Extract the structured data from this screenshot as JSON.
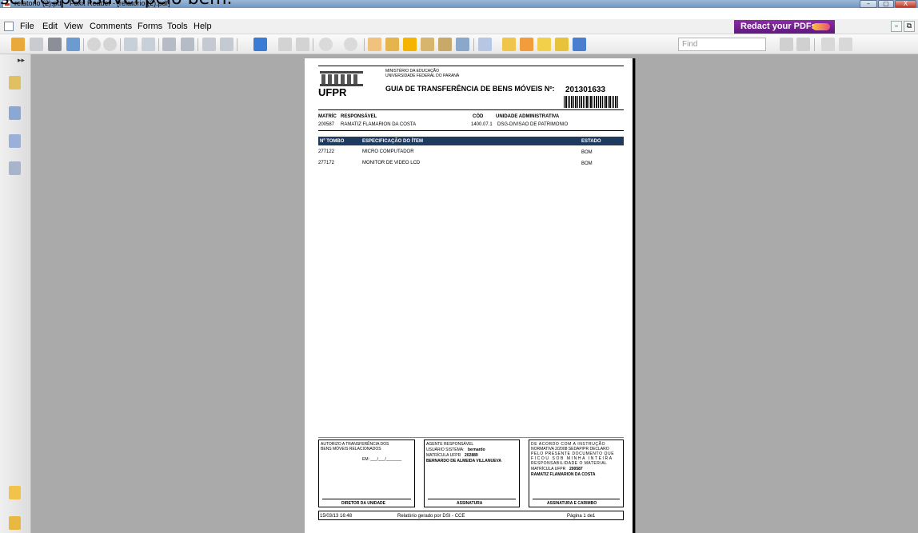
{
  "overlay_caption": "ser responsável pelo bem.",
  "window": {
    "title": "relatorio (2).pdf - Foxit Reader - [relatorio (2).pdf]",
    "minimize": "–",
    "maximize": "▢",
    "close": "X"
  },
  "menu": {
    "items": [
      "File",
      "Edit",
      "View",
      "Comments",
      "Forms",
      "Tools",
      "Help"
    ],
    "promo": "Redact your PDFs",
    "mdi_min": "–",
    "mdi_restore": "⧉"
  },
  "toolbar": {
    "find_placeholder": "Find",
    "accent": "#3a7bd5"
  },
  "document": {
    "header": {
      "ministry": "MINISTÉRIO DA EDUCAÇÃO",
      "university": "UNIVERSIDADE FEDERAL DO PARANÁ",
      "logo_text": "UFPR",
      "title": "GUIA DE TRANSFERÊNCIA DE BENS MÓVEIS Nº:",
      "number": "201301633"
    },
    "info": {
      "headers": [
        "MATRÍC",
        "RESPONSÁVEL",
        "CÓD",
        "UNIDADE ADMINISTRATIVA"
      ],
      "values": [
        "200587",
        "RAMATIZ FLAMARION DA COSTA",
        "1400.07.1",
        "DSG-DIVISAO DE PATRIMONIO"
      ]
    },
    "items_table": {
      "headers": [
        "Nº TOMBO",
        "ESPECIFICAÇÃO DO ÍTEM",
        "ESTADO"
      ],
      "rows": [
        [
          "277122",
          "MICRO COMPUTADOR",
          "BOM"
        ],
        [
          "277172",
          "MONITOR DE VIDEO LCD",
          "BOM"
        ]
      ],
      "header_bg": "#1f3a5f"
    },
    "signatures": {
      "left": {
        "line1": "AUTORIZO A TRANSFERÊNCIA DOS",
        "line2": "BENS MÓVEIS RELACIONADOS",
        "date": "EM: ___/___/_______",
        "footer": "DIRETOR DA UNIDADE"
      },
      "middle": {
        "line1": "AGENTE RESPONSÁVEL",
        "line2_label": "USUÁRIO SISTEMA:",
        "line2_value": "bernardo",
        "line3_label": "MATRÍCULA UFPR",
        "line3_value": "202889",
        "line4": "BERNARDO DE ALMEIDA VILLANUEVA",
        "footer": "ASSINATURA"
      },
      "right": {
        "line1": "DE ACORDO COM A INSTRUÇÃO",
        "line2": "NORMATIVA 2/2008 SEDAP/PR DECLARO",
        "line3": "PELO PRESENTE DOCUMENTO QUE",
        "line4": "FICOU SOB MINHA INTEIRA",
        "line5": "RESPONSABILIDADE O MATERIAL",
        "line6_label": "MATRÍCULA UFPR",
        "line6_value": "200587",
        "line7": "RAMATIZ FLAMARION DA COSTA",
        "footer": "ASSINATURA E CARIMBO"
      }
    },
    "footer": {
      "timestamp": "15/03/13 16:48",
      "generated": "Relatório gerado por DSI - CCE",
      "page": "Página 1 de1"
    }
  }
}
